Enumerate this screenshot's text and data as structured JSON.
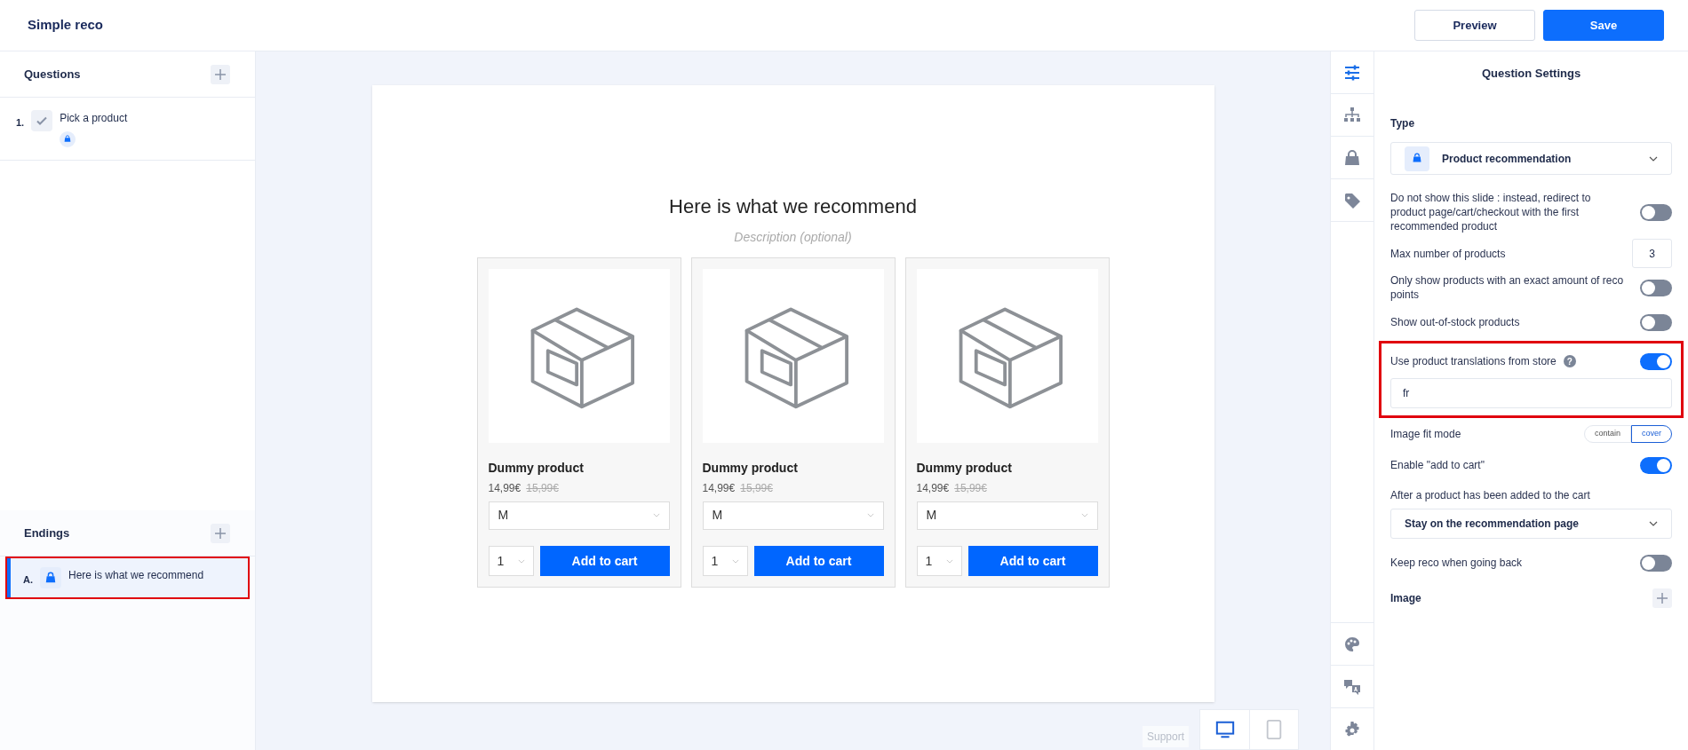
{
  "header": {
    "title": "Simple reco",
    "buttons": [
      {
        "label": "Preview",
        "kind": "secondary"
      },
      {
        "label": "Save",
        "kind": "primary"
      }
    ]
  },
  "sidebar": {
    "questions": {
      "title": "Questions",
      "items": [
        {
          "number": "1.",
          "label": "Pick a product",
          "selected": false,
          "highlighted": false
        }
      ]
    },
    "endings": {
      "title": "Endings",
      "items": [
        {
          "number": "A.",
          "label": "Here is what we recommend",
          "selected": true,
          "highlighted": true
        }
      ]
    }
  },
  "preview": {
    "title": "Here is what we recommend",
    "description_placeholder": "Description (optional)",
    "products": [
      {
        "name": "Dummy product",
        "price": "14,99€",
        "old_price": "15,99€",
        "variant": "M",
        "quantity": "1",
        "button": "Add to cart"
      },
      {
        "name": "Dummy product",
        "price": "14,99€",
        "old_price": "15,99€",
        "variant": "M",
        "quantity": "1",
        "button": "Add to cart"
      },
      {
        "name": "Dummy product",
        "price": "14,99€",
        "old_price": "15,99€",
        "variant": "M",
        "quantity": "1",
        "button": "Add to cart"
      }
    ]
  },
  "footer": {
    "support": "Support",
    "devices": [
      {
        "kind": "desktop",
        "selected": true
      },
      {
        "kind": "tablet",
        "selected": false
      }
    ]
  },
  "rail": {
    "top": [
      {
        "kind": "sliders",
        "selected": true
      },
      {
        "kind": "hierarchy",
        "selected": false
      },
      {
        "kind": "bag",
        "selected": false
      },
      {
        "kind": "tag",
        "selected": false
      }
    ],
    "bottom": [
      {
        "kind": "palette",
        "selected": false
      },
      {
        "kind": "translate",
        "selected": false
      },
      {
        "kind": "gear",
        "selected": false
      }
    ]
  },
  "settings": {
    "title": "Question Settings",
    "rows": [
      {
        "kind": "heading",
        "label": "Type"
      },
      {
        "kind": "type_select",
        "value": "Product recommendation"
      },
      {
        "kind": "toggle",
        "label": "Do not show this slide : instead, redirect to product page/cart/checkout with the first recommended product",
        "on": false
      },
      {
        "kind": "number",
        "label": "Max number of products",
        "value": "3"
      },
      {
        "kind": "toggle",
        "label": "Only show products with an exact amount of reco points",
        "on": false
      },
      {
        "kind": "toggle",
        "label": "Show out-of-stock products",
        "on": false
      },
      {
        "kind": "toggle",
        "label": "Use product translations from store",
        "on": true,
        "help": "?",
        "value": "fr",
        "highlighted": true
      },
      {
        "kind": "segmented",
        "label": "Image fit mode",
        "options": [
          {
            "label": "contain",
            "selected": false
          },
          {
            "label": "cover",
            "selected": true
          }
        ]
      },
      {
        "kind": "toggle",
        "label": "Enable \"add to cart\"",
        "on": true
      },
      {
        "kind": "text",
        "label": "After a product has been added to the cart"
      },
      {
        "kind": "select",
        "value": "Stay on the recommendation page"
      },
      {
        "kind": "toggle",
        "label": "Keep reco when going back",
        "on": false
      },
      {
        "kind": "heading_add",
        "label": "Image"
      }
    ]
  }
}
